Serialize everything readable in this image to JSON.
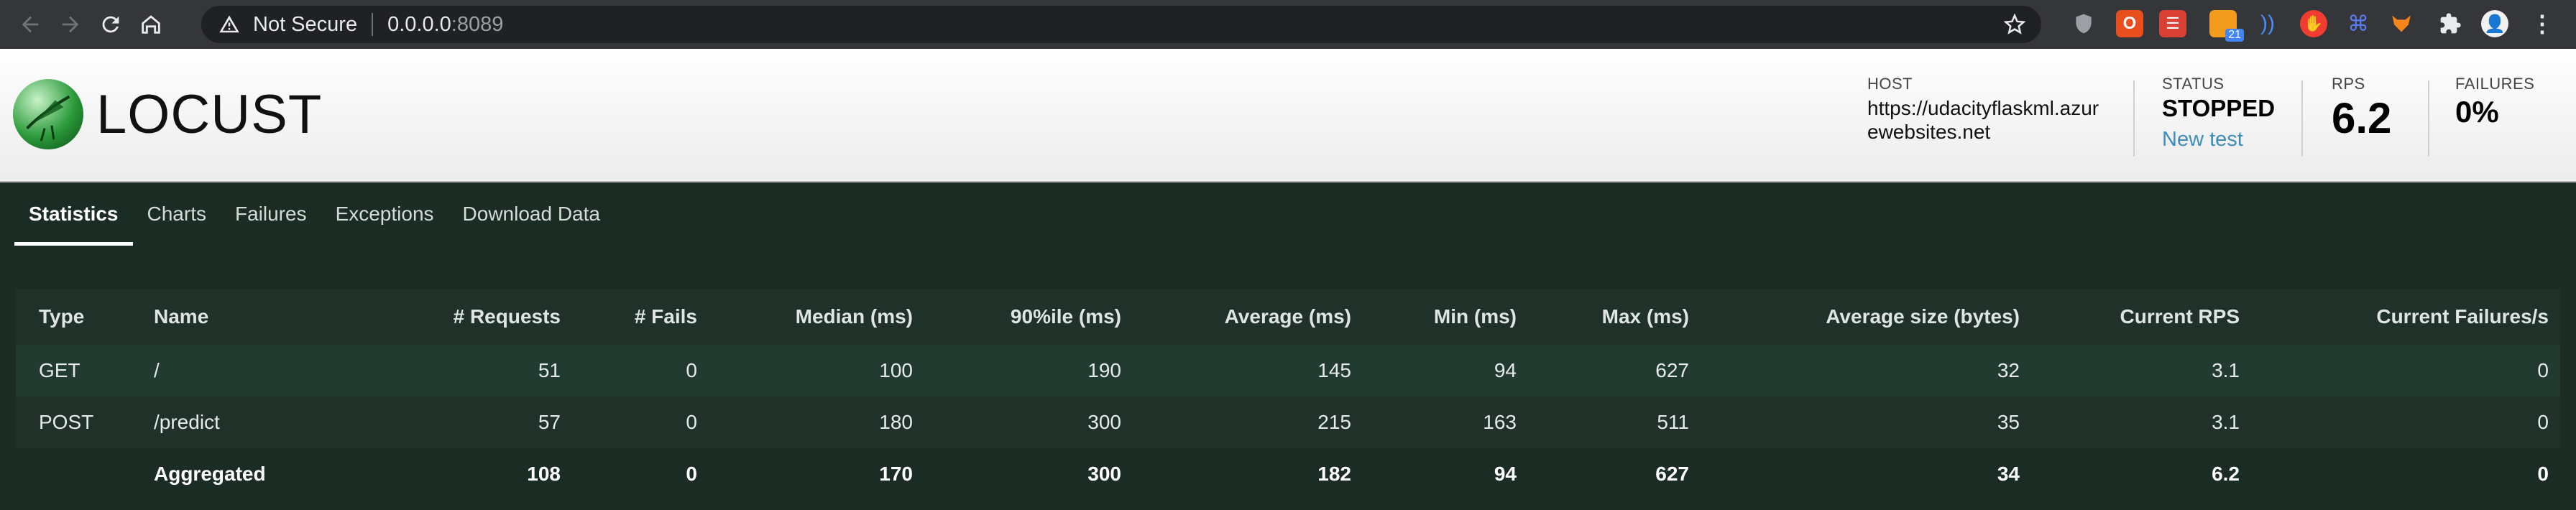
{
  "browser": {
    "security": "Not Secure",
    "host": "0.0.0.0",
    "port": ":8089",
    "extension_badge": "21"
  },
  "app": {
    "logo_text": "LOCUST",
    "host_label": "HOST",
    "host_value": "https://udacityflaskml.azurewebsites.net",
    "status_label": "STATUS",
    "status_value": "STOPPED",
    "new_test_label": "New test",
    "rps_label": "RPS",
    "rps_value": "6.2",
    "failures_label": "FAILURES",
    "failures_value": "0%"
  },
  "tabs": [
    "Statistics",
    "Charts",
    "Failures",
    "Exceptions",
    "Download Data"
  ],
  "table": {
    "headers": [
      "Type",
      "Name",
      "# Requests",
      "# Fails",
      "Median (ms)",
      "90%ile (ms)",
      "Average (ms)",
      "Min (ms)",
      "Max (ms)",
      "Average size (bytes)",
      "Current RPS",
      "Current Failures/s"
    ],
    "rows": [
      [
        "GET",
        "/",
        "51",
        "0",
        "100",
        "190",
        "145",
        "94",
        "627",
        "32",
        "3.1",
        "0"
      ],
      [
        "POST",
        "/predict",
        "57",
        "0",
        "180",
        "300",
        "215",
        "163",
        "511",
        "35",
        "3.1",
        "0"
      ],
      [
        "",
        "Aggregated",
        "108",
        "0",
        "170",
        "300",
        "182",
        "94",
        "627",
        "34",
        "6.2",
        "0"
      ]
    ]
  },
  "colors": {
    "header_bg": "#ffffff",
    "page_bg": "#1b2c25",
    "link": "#3c8dbc"
  }
}
